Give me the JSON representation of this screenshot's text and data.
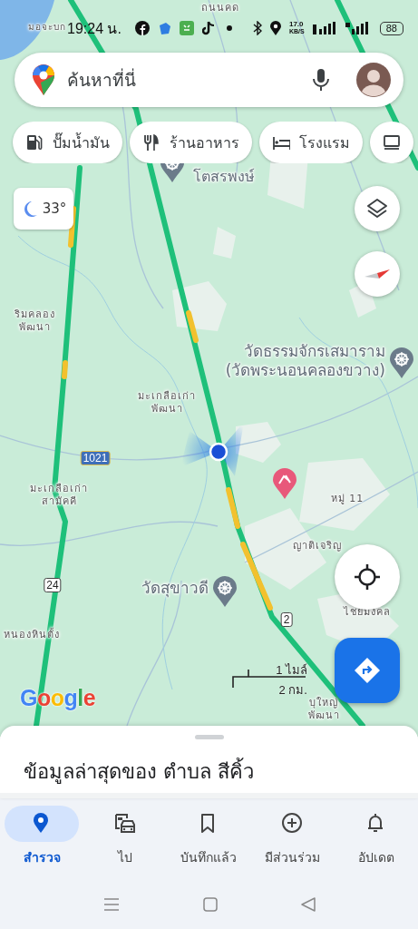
{
  "status_bar": {
    "time": "19:24 น.",
    "net_speed": "17.0",
    "net_unit": "KB/S",
    "battery": "88"
  },
  "search": {
    "placeholder": "ค้นหาที่นี่"
  },
  "chips": [
    {
      "kind": "gas",
      "label": "ปั๊มน้ำมัน"
    },
    {
      "kind": "restaurant",
      "label": "ร้านอาหาร"
    },
    {
      "kind": "hotel",
      "label": "โรงแรม"
    },
    {
      "kind": "shopping"
    }
  ],
  "weather": {
    "temperature": "33°"
  },
  "map_labels": [
    {
      "kind": "place",
      "lines": [
        "ถนนคด"
      ]
    },
    {
      "kind": "place",
      "lines": [
        "มอจะบก"
      ]
    },
    {
      "kind": "poi",
      "lines": [
        "โตสรพงษ์"
      ]
    },
    {
      "kind": "poi",
      "lines": [
        "วัดธรรมจักรเสมาราม",
        "(วัดพระนอนคลองขวาง)"
      ]
    },
    {
      "kind": "place",
      "lines": [
        "ริมคลอง",
        "พัฒนา"
      ]
    },
    {
      "kind": "place",
      "lines": [
        "มะเกลือเก่า",
        "พัฒนา"
      ]
    },
    {
      "kind": "shield",
      "lines": [
        "1021"
      ]
    },
    {
      "kind": "place",
      "lines": [
        "มะเกลือเก่า",
        "สามัคคี"
      ]
    },
    {
      "kind": "place",
      "lines": [
        "หมู่ 11"
      ]
    },
    {
      "kind": "place",
      "lines": [
        "ญาติเจริญ"
      ]
    },
    {
      "kind": "poi",
      "lines": [
        "วัดสุขาวดี"
      ]
    },
    {
      "kind": "shield",
      "lines": [
        "24"
      ]
    },
    {
      "kind": "place",
      "lines": [
        "ไชยมงคล"
      ]
    },
    {
      "kind": "shield",
      "lines": [
        "2"
      ]
    },
    {
      "kind": "place",
      "lines": [
        "หนองหินตั้ง"
      ]
    },
    {
      "kind": "place",
      "lines": [
        "บุใหญ่",
        "พัฒนา"
      ]
    }
  ],
  "scale": {
    "miles": "1 ไมล์",
    "km": "2 กม."
  },
  "logo": "Google",
  "sheet": {
    "title": "ข้อมูลล่าสุดของ ตำบล สีคิ้ว"
  },
  "nav": [
    {
      "kind": "explore",
      "label": "สำรวจ",
      "selected": true
    },
    {
      "kind": "go",
      "label": "ไป",
      "selected": false
    },
    {
      "kind": "saved",
      "label": "บันทึกแล้ว",
      "selected": false
    },
    {
      "kind": "contribute",
      "label": "มีส่วนร่วม",
      "selected": false
    },
    {
      "kind": "updates",
      "label": "อัปเดต",
      "selected": false
    }
  ]
}
